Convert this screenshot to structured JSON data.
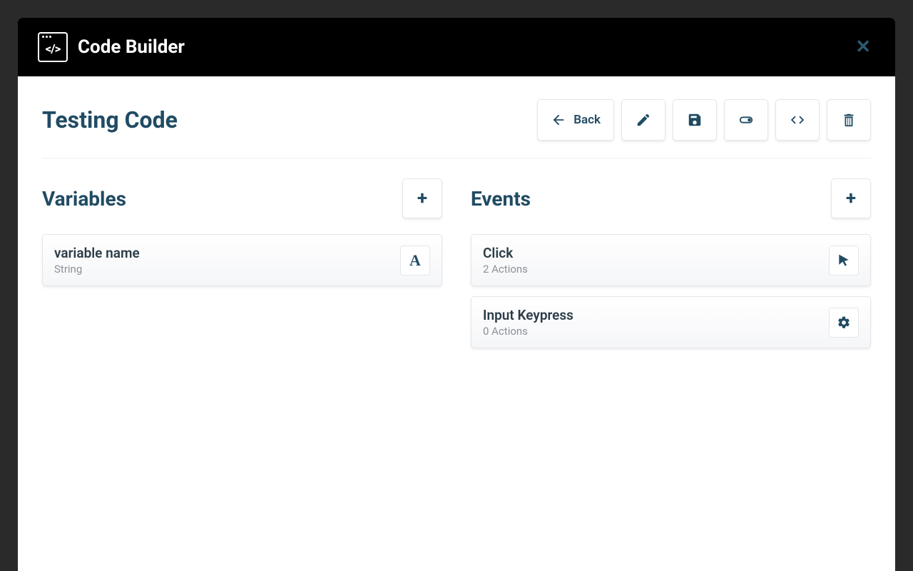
{
  "header": {
    "app_title": "Code Builder"
  },
  "page": {
    "title": "Testing Code"
  },
  "toolbar": {
    "back_label": "Back"
  },
  "variables": {
    "heading": "Variables",
    "items": [
      {
        "name": "variable name",
        "type": "String",
        "icon_letter": "A"
      }
    ]
  },
  "events": {
    "heading": "Events",
    "items": [
      {
        "name": "Click",
        "subtitle": "2 Actions",
        "icon": "cursor"
      },
      {
        "name": "Input Keypress",
        "subtitle": "0 Actions",
        "icon": "gear"
      }
    ]
  }
}
